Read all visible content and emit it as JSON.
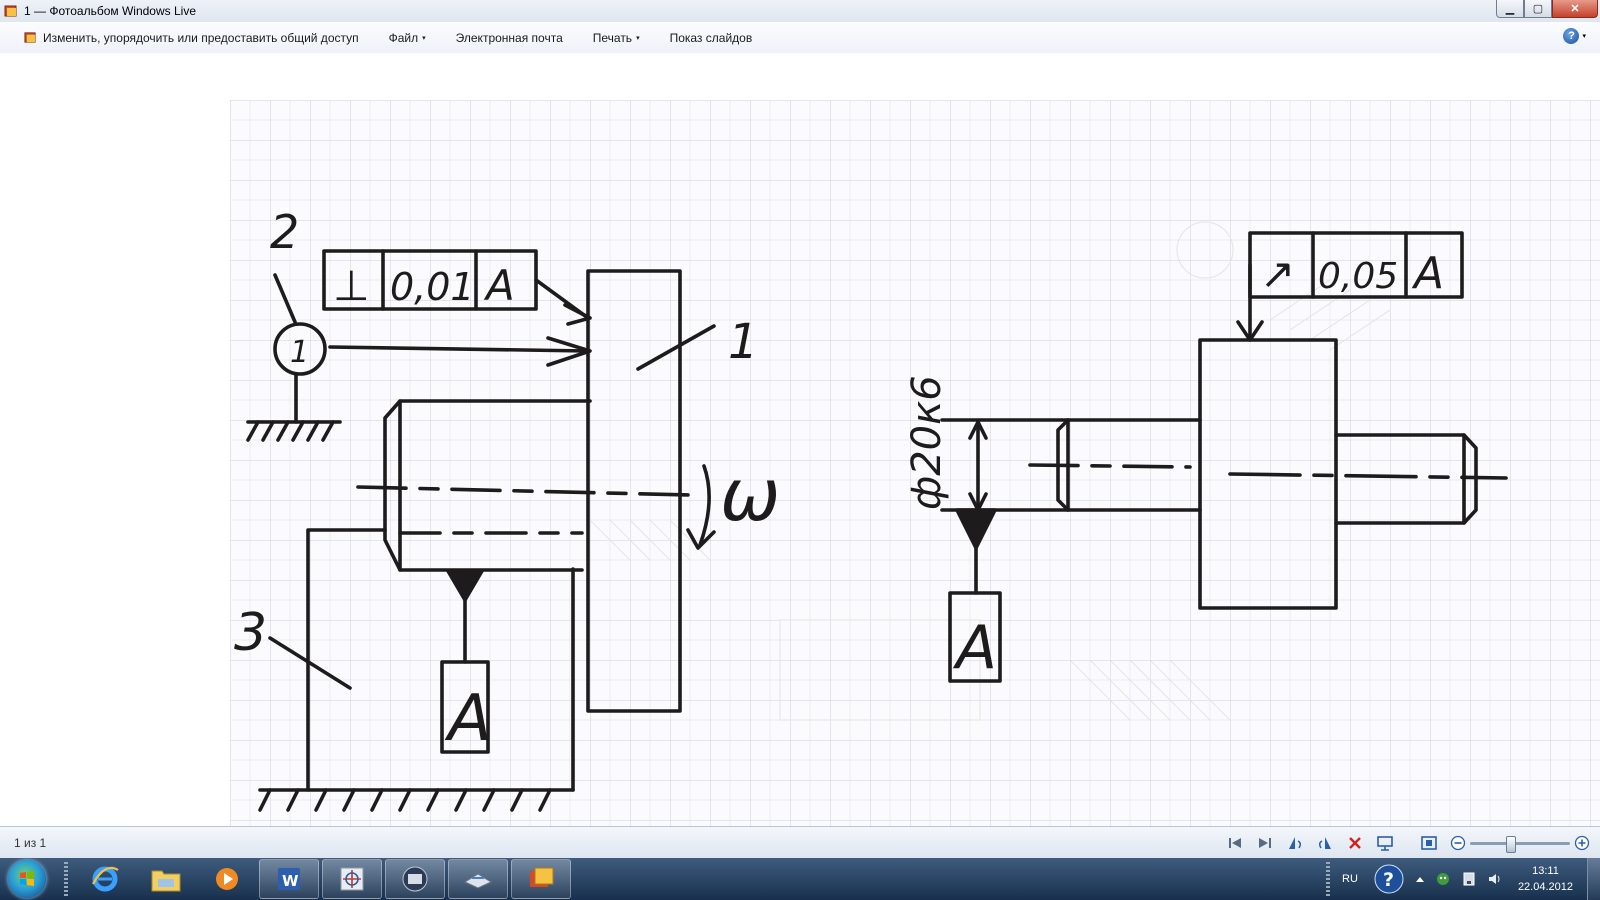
{
  "window": {
    "title": "1 — Фотоальбом Windows Live",
    "minimize": "▁",
    "maximize": "▢",
    "close": "✕"
  },
  "menu": {
    "items": [
      {
        "label": "Изменить, упорядочить или предоставить общий доступ",
        "icon": "photo-gallery-icon"
      },
      {
        "label": "Файл",
        "dropdown": "▾"
      },
      {
        "label": "Электронная почта"
      },
      {
        "label": "Печать",
        "dropdown": "▾"
      },
      {
        "label": "Показ слайдов"
      }
    ],
    "help": {
      "label": "?",
      "dropdown": "▾"
    }
  },
  "drawing": {
    "left": {
      "frame": [
        "⊥",
        "0,01",
        "A"
      ],
      "callout_1": "1",
      "callout_2": "2",
      "callout_3": "3",
      "omega": "ω",
      "gauge": "1",
      "datum": "A"
    },
    "right": {
      "frame": [
        "↗",
        "0,05",
        "A"
      ],
      "dimension": "ф20к6",
      "datum": "A"
    }
  },
  "status": {
    "count": "1 из 1",
    "zoom_level": 0.4
  },
  "taskbar": {
    "apps": [
      "internet-explorer-icon",
      "explorer-folder-icon",
      "media-player-icon",
      "word-icon",
      "compass-app-icon",
      "scanner-app-icon",
      "scanner-tray-icon",
      "photo-gallery-icon"
    ],
    "active_app": "photo-gallery-icon"
  },
  "tray": {
    "language": "RU",
    "time": "13:11",
    "date": "22.04.2012"
  },
  "colors": {
    "ink": "#1e1b1c",
    "grid": "#c9c8d8",
    "titlebar": "#dfe6f0",
    "taskbar": "#18304d"
  }
}
